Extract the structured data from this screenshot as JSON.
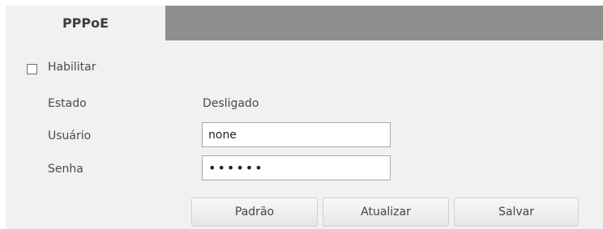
{
  "tabs": [
    {
      "label": "PPPoE",
      "active": true
    }
  ],
  "form": {
    "enable": {
      "label": "Habilitar",
      "checked": false
    },
    "status": {
      "label": "Estado",
      "value": "Desligado"
    },
    "username": {
      "label": "Usuário",
      "value": "none"
    },
    "password": {
      "label": "Senha",
      "value": "••••••"
    }
  },
  "buttons": {
    "default_label": "Padrão",
    "refresh_label": "Atualizar",
    "save_label": "Salvar"
  },
  "colors": {
    "tabbar_bg": "#8e8e8e",
    "panel_bg": "#f1f1f1"
  }
}
